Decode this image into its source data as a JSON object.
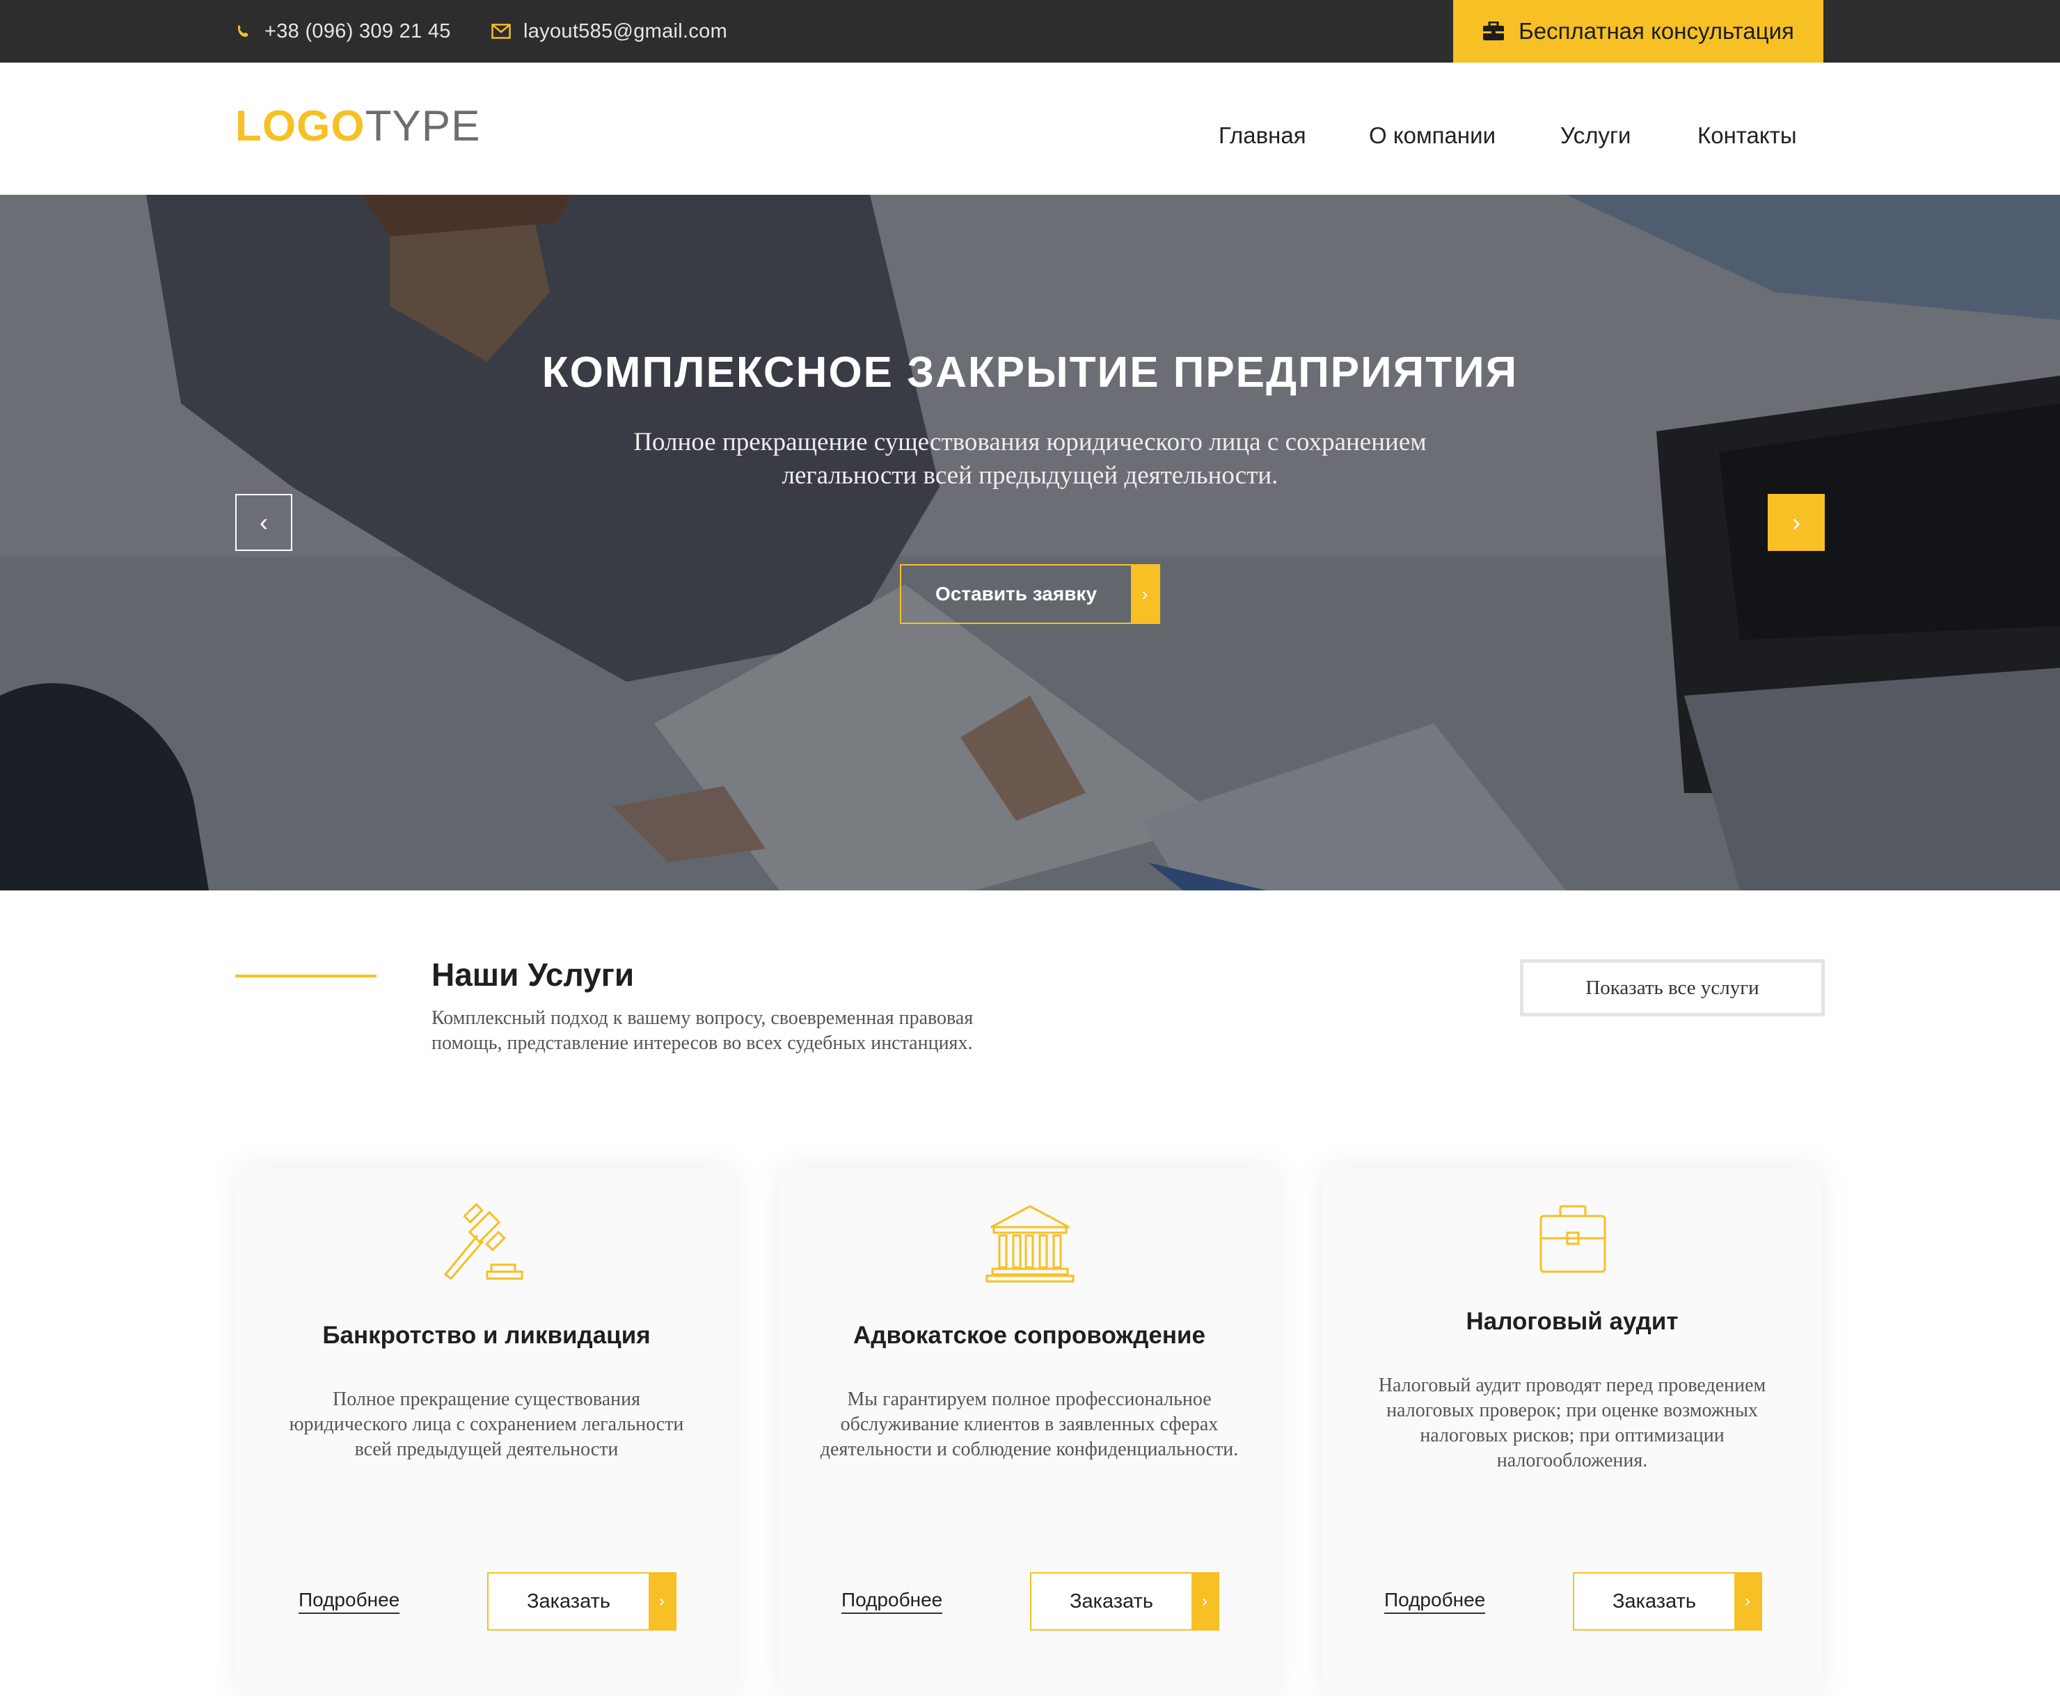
{
  "topbar": {
    "phone": "+38 (096) 309 21 45",
    "email": "layout585@gmail.com",
    "consult_button": "Бесплатная консультация"
  },
  "header": {
    "logo_part1": "LOGO",
    "logo_part2": "TYPE",
    "nav": [
      "Главная",
      "О компании",
      "Услуги",
      "Контакты"
    ]
  },
  "hero": {
    "title": "КОМПЛЕКСНОЕ ЗАКРЫТИЕ ПРЕДПРИЯТИЯ",
    "text": "Полное прекращение существования юридического лица с сохранением легальности всей предыдущей деятельности.",
    "button": "Оставить заявку",
    "prev": "‹",
    "next": "›"
  },
  "services": {
    "title": "Наши Услуги",
    "description": "Комплексный подход к вашему вопросу, своевременная правовая помощь, представление интересов во всех судебных инстанциях.",
    "show_all": "Показать все услуги",
    "cards": [
      {
        "icon": "gavel-icon",
        "title": "Банкротство и ликвидация",
        "text": "Полное прекращение существования юридического лица с сохранением легальности всей предыдущей деятельности",
        "more": "Подробнее",
        "order": "Заказать"
      },
      {
        "icon": "courthouse-icon",
        "title": "Адвокатское сопровождение",
        "text": "Мы гарантируем полное профессиональное обслуживание клиентов в заявленных сферах деятельности и соблюдение конфиденциальности.",
        "more": "Подробнее",
        "order": "Заказать"
      },
      {
        "icon": "briefcase-icon",
        "title": "Налоговый аудит",
        "text": "Налоговый аудит проводят перед проведением налоговых проверок; при оценке возможных налоговых рисков; при оптимизации налогообложения.",
        "more": "Подробнее",
        "order": "Заказать"
      }
    ]
  },
  "colors": {
    "accent": "#f7c024",
    "topbar_bg": "#2d2d2d"
  }
}
